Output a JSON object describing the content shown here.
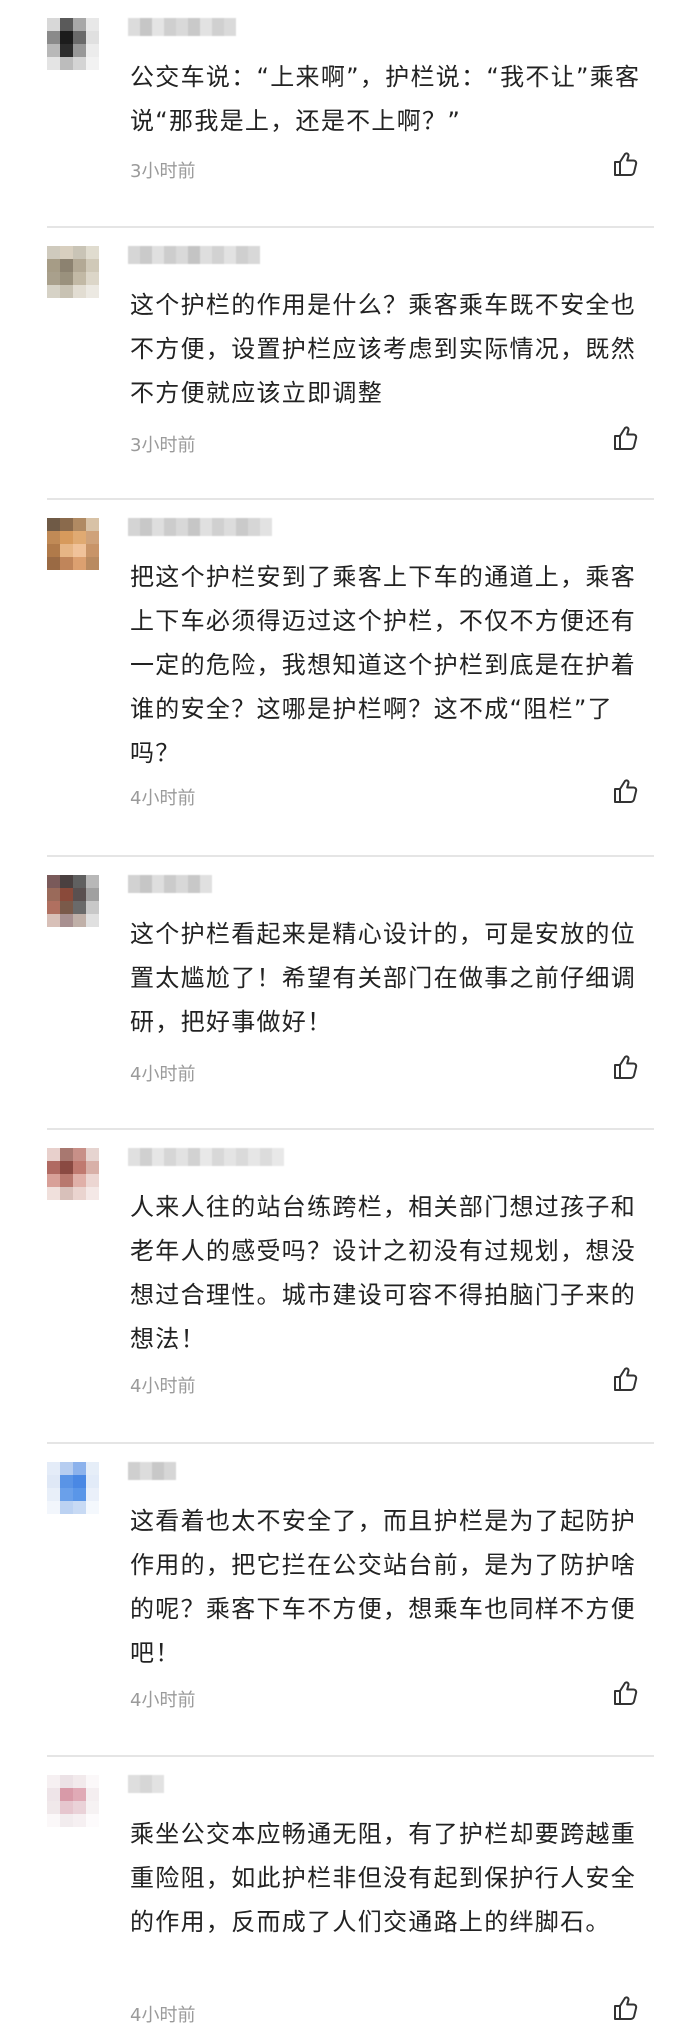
{
  "comments": [
    {
      "text": "公交车说：“上来啊”，护栏说：“我不让”乘客说“那我是上，还是不上啊？”",
      "time": "3小时前",
      "avatar_colors": [
        "#d8d8d8",
        "#5a5a5a",
        "#a8a8a8",
        "#e8e8e8",
        "#8a8a8a",
        "#1c1c1c",
        "#6a6a6a",
        "#e0e0e0",
        "#b8b8b8",
        "#2c2c2c",
        "#989898",
        "#ececec",
        "#e4e4e4",
        "#bcbcbc",
        "#d4d4d4",
        "#f2f2f2"
      ],
      "name_colors": [
        "#dcdcdc",
        "#c6c6c6",
        "#e4e4e4",
        "#cfcfcf",
        "#d9d9d9",
        "#c9c9c9",
        "#e2e2e2",
        "#d0d0d0",
        "#dadada"
      ]
    },
    {
      "text": "这个护栏的作用是什么？乘客乘车既不安全也不方便，设置护栏应该考虑到实际情况，既然不方便就应该立即调整",
      "time": "3小时前",
      "avatar_colors": [
        "#cfcabd",
        "#d8cfbf",
        "#c9c4b6",
        "#e0dccf",
        "#a69c86",
        "#8c8270",
        "#b3a995",
        "#d0c9b8",
        "#a9a08c",
        "#9a917d",
        "#c2b9a5",
        "#dcd6c8",
        "#d6d2c6",
        "#c8c2b3",
        "#e2ddd2",
        "#ece9e2"
      ],
      "name_colors": [
        "#d6d6d6",
        "#cacaca",
        "#e0e0e0",
        "#cdcdcd",
        "#d9d9d9",
        "#c4c4c4",
        "#dedede",
        "#d2d2d2",
        "#e2e2e2",
        "#cfcfcf",
        "#d8d8d8"
      ]
    },
    {
      "text": "把这个护栏安到了乘客上下车的通道上，乘客上下车必须得迈过这个护栏，不仅不方便还有一定的危险，我想知道这个护栏到底是在护着谁的安全？这哪是护栏啊？这不成“阻栏”了吗？",
      "time": "4小时前",
      "avatar_colors": [
        "#6f5a46",
        "#8a6a4c",
        "#b08a63",
        "#d8c2a6",
        "#c08a56",
        "#d79a5c",
        "#e0aa72",
        "#cfa27a",
        "#b07a4a",
        "#e6b585",
        "#f0c29a",
        "#c89468",
        "#9a6a44",
        "#c0855a",
        "#dca070",
        "#b98a60"
      ],
      "name_colors": [
        "#d4d4d4",
        "#c8c8c8",
        "#dedede",
        "#cccccc",
        "#d8d8d8",
        "#c6c6c6",
        "#e0e0e0",
        "#d0d0d0",
        "#dcdcdc",
        "#cacaca",
        "#d6d6d6",
        "#e2e2e2"
      ]
    },
    {
      "text": "这个护栏看起来是精心设计的，可是安放的位置太尴尬了！希望有关部门在做事之前仔细调研，把好事做好！",
      "time": "4小时前",
      "avatar_colors": [
        "#7a5a5a",
        "#4a4040",
        "#606060",
        "#b8b8b8",
        "#9a6a5a",
        "#8a4a3a",
        "#5a5050",
        "#a0a0a0",
        "#b07060",
        "#7a5a4a",
        "#6a6a6a",
        "#c8c8c8",
        "#d8c0b8",
        "#a89090",
        "#c0b0a8",
        "#e0e0e0"
      ],
      "name_colors": [
        "#d2d2d2",
        "#c6c6c6",
        "#dedede",
        "#cbcbcb",
        "#d8d8d8",
        "#c8c8c8",
        "#e0e0e0"
      ]
    },
    {
      "text": "人来人往的站台练跨栏，相关部门想过孩子和老年人的感受吗？设计之初没有过规划，想没想过合理性。城市建设可容不得拍脑门子来的想法！",
      "time": "4小时前",
      "avatar_colors": [
        "#e8d0cc",
        "#a87870",
        "#c89088",
        "#e6d4d0",
        "#b06a62",
        "#8a4a42",
        "#c07a70",
        "#d8b0a8",
        "#d8a098",
        "#b8786e",
        "#e0b0a8",
        "#ecd6d2",
        "#f0e0dc",
        "#d8c0ba",
        "#ead4cf",
        "#f4e8e6"
      ],
      "name_colors": [
        "#e0e0e0",
        "#d0d0d0",
        "#e6e6e6",
        "#d6d6d6",
        "#e2e2e2",
        "#d2d2d2",
        "#e8e8e8",
        "#d8d8d8",
        "#e4e4e4",
        "#dadada",
        "#e6e6e6",
        "#dcdcdc",
        "#e8e8e8"
      ]
    },
    {
      "text": "这看着也太不安全了，而且护栏是为了起防护作用的，把它拦在公交站台前，是为了防护啥的呢？乘客下车不方便，想乘车也同样不方便吧！",
      "time": "4小时前",
      "avatar_colors": [
        "#e4ecf8",
        "#b6cdf0",
        "#8cb2ec",
        "#e6eef8",
        "#dfe8f6",
        "#5a94e6",
        "#4a88e4",
        "#e2ebf8",
        "#e8eff9",
        "#6aa0ea",
        "#5a96e8",
        "#eaf0fa",
        "#f2f6fc",
        "#bcd2f2",
        "#c8daf4",
        "#f4f8fd"
      ],
      "name_colors": [
        "#cfcfcf",
        "#dcdcdc",
        "#c8c8c8",
        "#d6d6d6"
      ]
    },
    {
      "text": "乘坐公交本应畅通无阻，有了护栏却要跨越重重险阻，如此护栏非但没有起到保护行人安全的作用，反而成了人们交通路上的绊脚石。",
      "time": "4小时前",
      "avatar_colors": [
        "#f6f0f2",
        "#ece2e6",
        "#f2eaec",
        "#fbf8f9",
        "#eee4e8",
        "#d89aa8",
        "#e0aab6",
        "#f4eef0",
        "#f0e8ea",
        "#e6c6ce",
        "#ead2d8",
        "#f6f2f3",
        "#fbf8f9",
        "#f2ecee",
        "#f6f0f2",
        "#fdfbfc"
      ],
      "name_colors": [
        "#dedede",
        "#d6d6d6",
        "#e2e2e2"
      ]
    }
  ]
}
